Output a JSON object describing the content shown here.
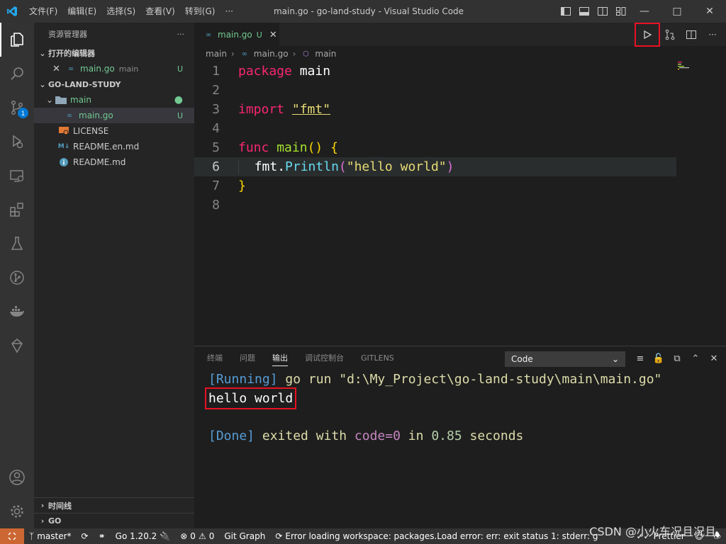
{
  "titlebar": {
    "menu": [
      "文件(F)",
      "编辑(E)",
      "选择(S)",
      "查看(V)",
      "转到(G)",
      "···"
    ],
    "title": "main.go - go-land-study - Visual Studio Code"
  },
  "activitybar": {
    "items": [
      "explorer-icon",
      "search-icon",
      "source-control-icon",
      "run-debug-icon",
      "remote-explorer-icon",
      "extensions-icon",
      "testing-icon",
      "git-graph-icon",
      "docker-icon",
      "gitlens-icon"
    ],
    "scm_badge": "1",
    "bottom": [
      "account-icon",
      "manage-gear-icon"
    ]
  },
  "sidebar": {
    "header": "资源管理器",
    "more": "···",
    "open_editors": {
      "title": "打开的编辑器",
      "file": "main.go",
      "folder": "main",
      "status": "U"
    },
    "workspace": {
      "title": "GO-LAND-STUDY",
      "folder": "main",
      "file": "main.go",
      "file_status": "U",
      "files": [
        "LICENSE",
        "README.en.md",
        "README.md"
      ]
    },
    "timeline": "时间线",
    "go": "GO"
  },
  "editor": {
    "tab": {
      "label": "main.go",
      "status": "U"
    },
    "breadcrumb": [
      "main",
      "main.go",
      "main"
    ],
    "line_numbers": [
      "1",
      "2",
      "3",
      "4",
      "5",
      "6",
      "7",
      "8"
    ],
    "code": {
      "l1_kw": "package",
      "l1_name": "main",
      "l3_kw": "import",
      "l3_str": "\"fmt\"",
      "l5_kw": "func",
      "l5_name": "main",
      "l5_rest": "()",
      "l5_brace": "{",
      "l6_pkg": "fmt",
      "l6_dot": ".",
      "l6_fn": "Println",
      "l6_open": "(",
      "l6_str": "\"hello world\"",
      "l6_close": ")",
      "l7_brace": "}"
    }
  },
  "panel": {
    "tabs": [
      "终端",
      "问题",
      "输出",
      "调试控制台",
      "GITLENS"
    ],
    "active_tab": "输出",
    "channel": "Code",
    "output": {
      "running": "[Running]",
      "cmd": " go run \"d:\\My_Project\\go-land-study\\main\\main.go\"",
      "result": "hello world",
      "done": "[Done]",
      "exited": " exited with ",
      "code": "code=0",
      "in": " in ",
      "secs": "0.85",
      "seconds": " seconds"
    }
  },
  "statusbar": {
    "branch": "master*",
    "go_version": "Go 1.20.2",
    "errors": "0",
    "warnings": "0",
    "git_graph": "Git Graph",
    "message": "Error loading workspace: packages.Load error: err: exit status 1: stderr: g",
    "prettier": "Prettier"
  },
  "watermark": "CSDN @小火车况且况且",
  "colors": {
    "accent": "#0078d4",
    "highlight_box": "#e81123",
    "remote": "#cc6633"
  }
}
